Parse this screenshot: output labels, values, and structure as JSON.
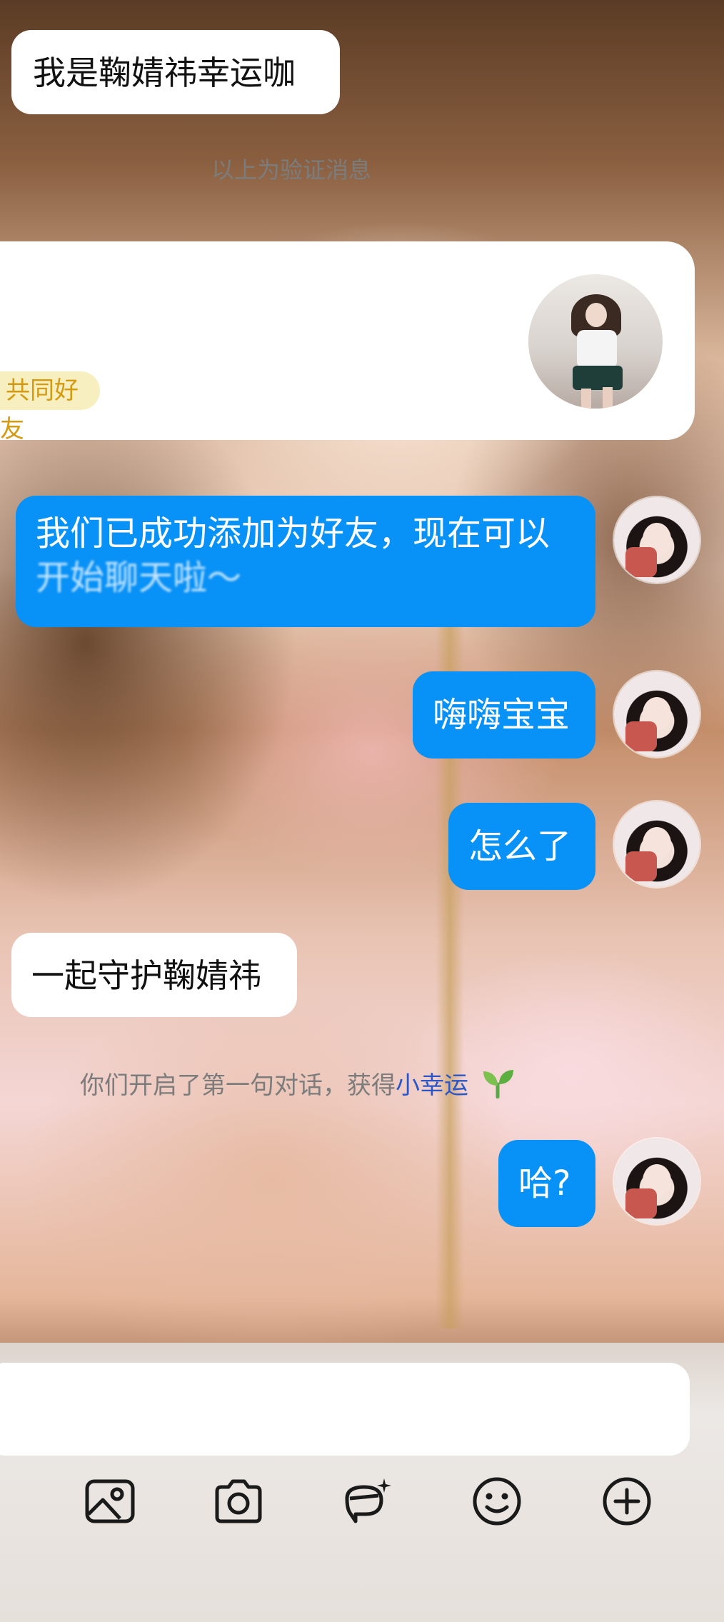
{
  "chat": {
    "verify_message": "我是鞠婧祎幸运咖",
    "verify_notice": "以上为验证消息",
    "friend_card": {
      "mutual_friends": "共同好友"
    },
    "messages": [
      {
        "side": "right",
        "text_line1": "我们已成功添加为好友，现在可以",
        "text_line2": "开始聊天啦～"
      },
      {
        "side": "right",
        "text": "嗨嗨宝宝"
      },
      {
        "side": "right",
        "text": "怎么了"
      },
      {
        "side": "left",
        "text": "一起守护鞠婧祎"
      },
      {
        "side": "right",
        "text": "哈?"
      }
    ],
    "system_notice": {
      "prefix": "你们开启了第一句对话，获得",
      "highlight": "小幸运",
      "highlight_color": "#2b56c9"
    }
  },
  "input_bar": {
    "value": ""
  },
  "toolbar": {
    "icons": [
      "image-icon",
      "camera-icon",
      "ai-assistant-icon",
      "emoji-icon",
      "plus-icon"
    ]
  },
  "colors": {
    "self_bubble": "#0891f6",
    "other_bubble": "#ffffff",
    "mutual_badge": "#f8efc0"
  }
}
